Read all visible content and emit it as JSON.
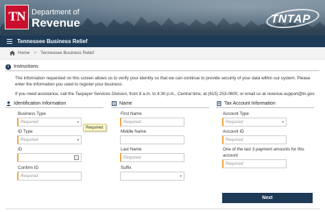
{
  "header": {
    "logo_text": "TN",
    "dept_line1": "Department of",
    "dept_line2": "Revenue",
    "app_logo": "TNTAP"
  },
  "nav": {
    "title": "Tennessee Business Relief",
    "menu_icon": "hamburger-icon"
  },
  "breadcrumb": {
    "home": "Home",
    "separator": ">",
    "current": "Tennessee Business Relief"
  },
  "instructions": {
    "heading": "Instructions",
    "para1": "The information requested on this screen allows us to verify your identity so that we can continue to provide security of your data within our system. Please enter the information you used to register your business.",
    "para2": "If you need assistance, call the Taxpayer Services Division, from 8 a.m. to 4:30 p.m., Central time, at (615) 253-0600, or email us at revenue.support@tn.gov."
  },
  "identification": {
    "heading": "Identification Information",
    "business_type_label": "Business Type",
    "business_type_placeholder": "Required",
    "id_type_label": "ID Type",
    "id_type_placeholder": "Required",
    "id_label": "ID",
    "confirm_id_label": "Confirm ID",
    "confirm_id_placeholder": "Required"
  },
  "tooltip": "Required",
  "name": {
    "heading": "Name",
    "first_name_label": "First Name",
    "first_name_placeholder": "Required",
    "middle_name_label": "Middle Name",
    "last_name_label": "Last Name",
    "last_name_placeholder": "Required",
    "suffix_label": "Suffix"
  },
  "tax_account": {
    "heading": "Tax Account Information",
    "account_type_label": "Account Type",
    "account_type_placeholder": "Required",
    "account_id_label": "Account ID",
    "account_id_placeholder": "Required",
    "payment_label_line1": "One of the last 3 payment amounts for this",
    "payment_label_line2": "account",
    "payment_placeholder": "Required"
  },
  "actions": {
    "next_label": "Next"
  },
  "colors": {
    "navy": "#1d3a57",
    "required_accent": "#f2a33a",
    "logo_red": "#c8102e",
    "tooltip_bg": "#fffbcc"
  }
}
